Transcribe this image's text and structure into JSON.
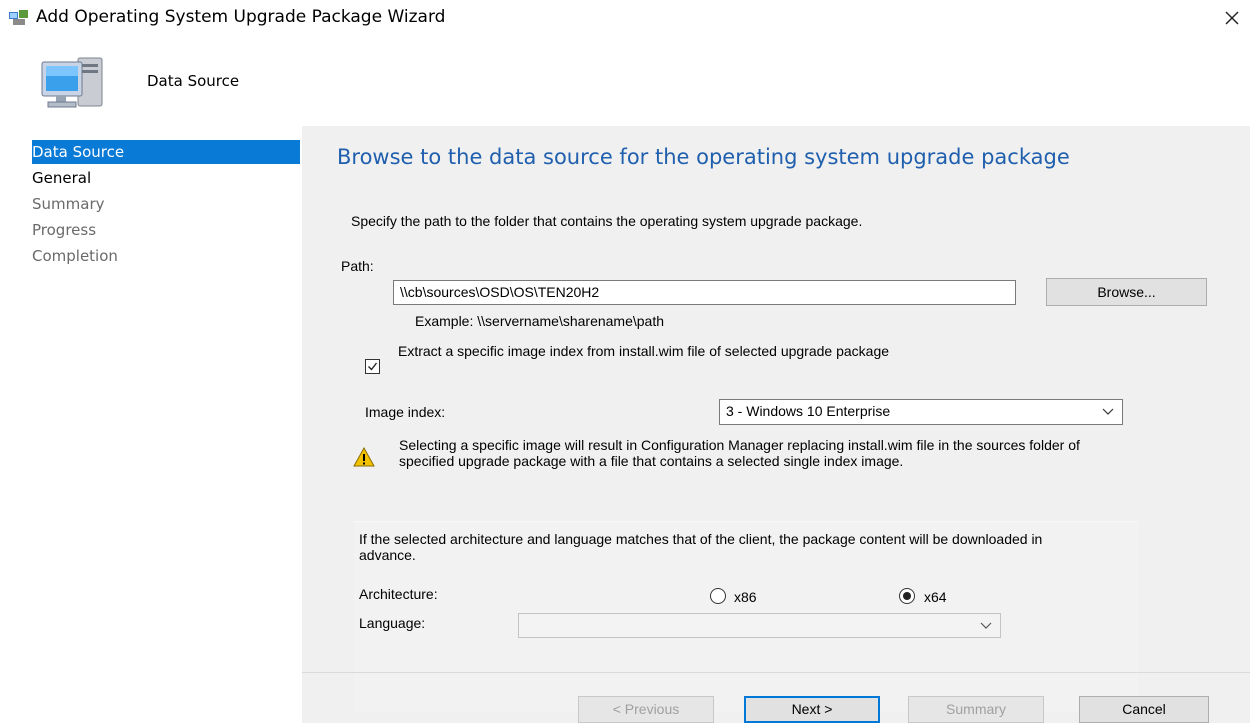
{
  "window": {
    "title": "Add Operating System Upgrade Package Wizard"
  },
  "header": {
    "title": "Data Source"
  },
  "sidebar": {
    "items": [
      {
        "label": "Data Source",
        "state": "active"
      },
      {
        "label": "General",
        "state": "current"
      },
      {
        "label": "Summary",
        "state": "dim"
      },
      {
        "label": "Progress",
        "state": "dim"
      },
      {
        "label": "Completion",
        "state": "dim"
      }
    ]
  },
  "main": {
    "heading": "Browse to the data source for the operating system upgrade package",
    "description": "Specify the path to the folder that contains the operating system upgrade package.",
    "path_label": "Path:",
    "path_value": "\\\\cb\\sources\\OSD\\OS\\TEN20H2",
    "browse_label": "Browse...",
    "example_text": "Example: \\\\servername\\sharename\\path",
    "extract_checkbox": {
      "label": "Extract a specific image index from install.wim file of selected upgrade package",
      "checked": true
    },
    "image_index_label": "Image index:",
    "image_index_value": "3 - Windows 10 Enterprise",
    "warning_text": "Selecting a specific image will result in Configuration Manager replacing install.wim file in the sources folder of specified upgrade package with a file that contains a selected single index image.",
    "info_text": "If the selected architecture and language matches that of the client, the package content will be downloaded in advance.",
    "architecture_label": "Architecture:",
    "arch_options": [
      {
        "label": "x86",
        "selected": false
      },
      {
        "label": "x64",
        "selected": true
      }
    ],
    "language_label": "Language:",
    "language_value": ""
  },
  "footer": {
    "previous_label": "< Previous",
    "next_label": "Next >",
    "summary_label": "Summary",
    "cancel_label": "Cancel"
  },
  "colors": {
    "accent": "#0a7ad7",
    "heading": "#1f5fae",
    "panel": "#f0f0f0",
    "warning": "#f2c200"
  }
}
